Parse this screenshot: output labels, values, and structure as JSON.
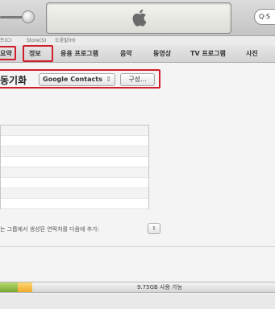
{
  "search": {
    "label": "Q·S"
  },
  "menubar": {
    "items": [
      "트(C)",
      "Store(S)",
      "도움말(H)"
    ]
  },
  "tabs": [
    {
      "label": "요약"
    },
    {
      "label": "정보"
    },
    {
      "label": "응용 프로그램"
    },
    {
      "label": "음악"
    },
    {
      "label": "동영상"
    },
    {
      "label": "TV 프로그램"
    },
    {
      "label": "사진"
    }
  ],
  "sync": {
    "title": "동기화",
    "source_value": "Google Contacts",
    "configure_label": "구성..."
  },
  "groups": {
    "add_contacts_text": "는 그룹에서 생성된 연락처를 다음에 추가:"
  },
  "capacity": {
    "free_label": "9.75GB 사용 가능",
    "colors": {
      "green": "#8bb843",
      "yellow": "#f5bb40"
    }
  },
  "highlight_color": "#d01f2a"
}
